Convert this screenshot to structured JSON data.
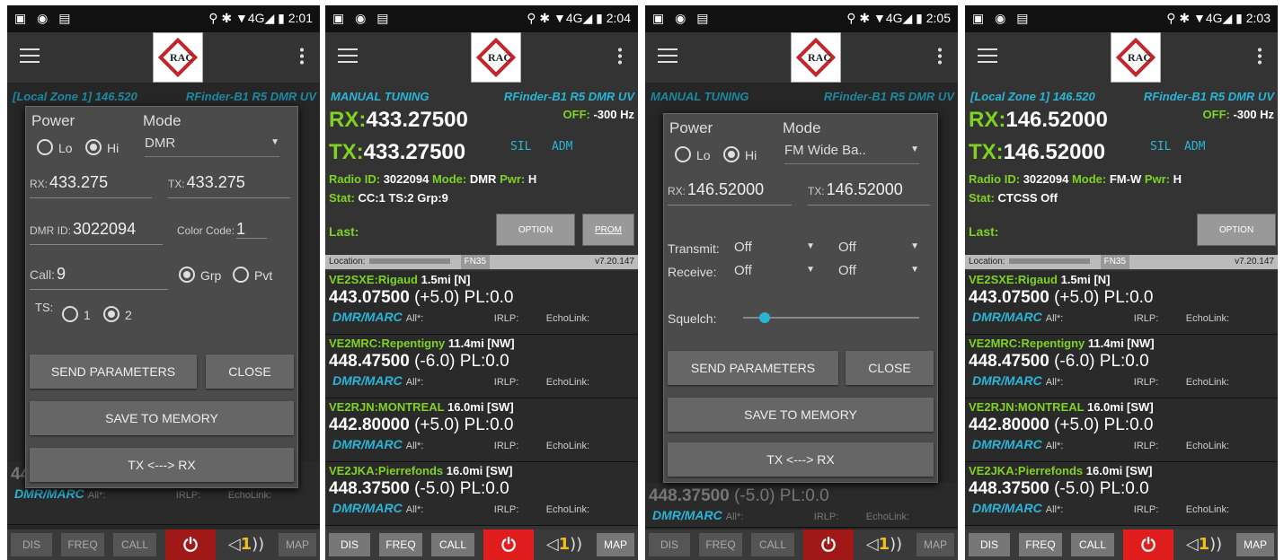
{
  "status": {
    "icons": "▣ ◉ ▤",
    "time1": "2:01",
    "time2": "2:04",
    "time3": "2:05",
    "time4": "2:03",
    "right": "⚲ ✱ ▼4G◢ ▮"
  },
  "app": {
    "logo": "RAC"
  },
  "colors": {
    "accent": "#2ab5d6",
    "green": "#7ed321",
    "power": "#e01e1e"
  },
  "s1": {
    "zone": "[Local Zone 1] 146.520",
    "radio": "RFinder-B1 R5 DMR UV"
  },
  "s2": {
    "zone": "MANUAL TUNING",
    "radio": "RFinder-B1 R5 DMR UV",
    "rx_label": "RX:",
    "rx": "433.27500",
    "tx_label": "TX:",
    "tx": "433.27500",
    "off_label": "OFF:",
    "off": "-300 Hz",
    "sil": "SIL",
    "adm": "ADM",
    "radio_id_label": "Radio ID:",
    "radio_id": "3022094",
    "mode_label": "Mode:",
    "mode": "DMR",
    "pwr_label": "Pwr:",
    "pwr": "H",
    "stat_label": "Stat:",
    "stat": "CC:1   TS:2   Grp:9",
    "last": "Last:",
    "option": "OPTION",
    "prom": "PROM"
  },
  "s4": {
    "zone": "[Local Zone 1] 146.520",
    "radio": "RFinder-B1 R5 DMR UV",
    "rx_label": "RX:",
    "rx": "146.52000",
    "tx_label": "TX:",
    "tx": "146.52000",
    "off_label": "OFF:",
    "off": "-300 Hz",
    "sil": "SIL",
    "adm": "ADM",
    "radio_id_label": "Radio ID:",
    "radio_id": "3022094",
    "mode_label": "Mode:",
    "mode": "FM-W",
    "pwr_label": "Pwr:",
    "pwr": "H",
    "stat_label": "Stat:",
    "stat": "CTCSS Off",
    "last": "Last:",
    "option": "OPTION"
  },
  "loc": {
    "label": "Location:",
    "grid": "FN35",
    "version": "v7.20.147"
  },
  "repeaters": [
    {
      "call": "VE2SXE:Rigaud",
      "dist": "1.5mi [N]",
      "freq": "443.07500",
      "offset": "(+5.0) PL:0.0",
      "mode": "DMR/MARC",
      "all": "All*:",
      "irlp": "IRLP:",
      "echo": "EchoLink:"
    },
    {
      "call": "VE2MRC:Repentigny",
      "dist": "11.4mi [NW]",
      "freq": "448.47500",
      "offset": "(-6.0) PL:0.0",
      "mode": "DMR/MARC",
      "all": "All*:",
      "irlp": "IRLP:",
      "echo": "EchoLink:"
    },
    {
      "call": "VE2RJN:MONTREAL",
      "dist": "16.0mi [SW]",
      "freq": "442.80000",
      "offset": "(+5.0) PL:0.0",
      "mode": "DMR/MARC",
      "all": "All*:",
      "irlp": "IRLP:",
      "echo": "EchoLink:"
    },
    {
      "call": "VE2JKA:Pierrefonds",
      "dist": "16.0mi [SW]",
      "freq": "448.37500",
      "offset": "(-5.0) PL:0.0",
      "mode": "DMR/MARC",
      "all": "All*:",
      "irlp": "IRLP:",
      "echo": "EchoLink:"
    }
  ],
  "bottom": {
    "dis": "DIS",
    "freq": "FREQ",
    "call": "CALL",
    "power": "⏻",
    "vol": "◁",
    "vol2": "1",
    "vol3": "))",
    "map": "MAP"
  },
  "d1": {
    "power": "Power",
    "mode": "Mode",
    "lo": "Lo",
    "hi": "Hi",
    "mode_val": "DMR",
    "rx_label": "RX:",
    "rx": "433.275",
    "tx_label": "TX:",
    "tx": "433.275",
    "dmr_label": "DMR ID:",
    "dmr": "3022094",
    "cc_label": "Color Code:",
    "cc": "1",
    "call_label": "Call:",
    "call": "9",
    "grp": "Grp",
    "pvt": "Pvt",
    "ts_label": "TS:",
    "ts1": "1",
    "ts2": "2",
    "send": "SEND PARAMETERS",
    "close": "CLOSE",
    "save": "SAVE TO MEMORY",
    "swap": "TX <---> RX"
  },
  "d3": {
    "power": "Power",
    "mode": "Mode",
    "lo": "Lo",
    "hi": "Hi",
    "mode_val": "FM Wide Ba..",
    "rx_label": "RX:",
    "rx": "146.52000",
    "tx_label": "TX:",
    "tx": "146.52000",
    "transmit": "Transmit:",
    "tx_a": "Off",
    "tx_b": "Off",
    "receive": "Receive:",
    "rx_a": "Off",
    "rx_b": "Off",
    "squelch": "Squelch:",
    "squelch_level": 0.12,
    "send": "SEND PARAMETERS",
    "close": "CLOSE",
    "save": "SAVE TO MEMORY",
    "swap": "TX <---> RX"
  },
  "under3": {
    "freq": "448.37500",
    "offset": "(-5.0) PL:0.0",
    "mode": "DMR/MARC",
    "all": "All*:",
    "irlp": "IRLP:",
    "echo": "EchoLink:"
  }
}
